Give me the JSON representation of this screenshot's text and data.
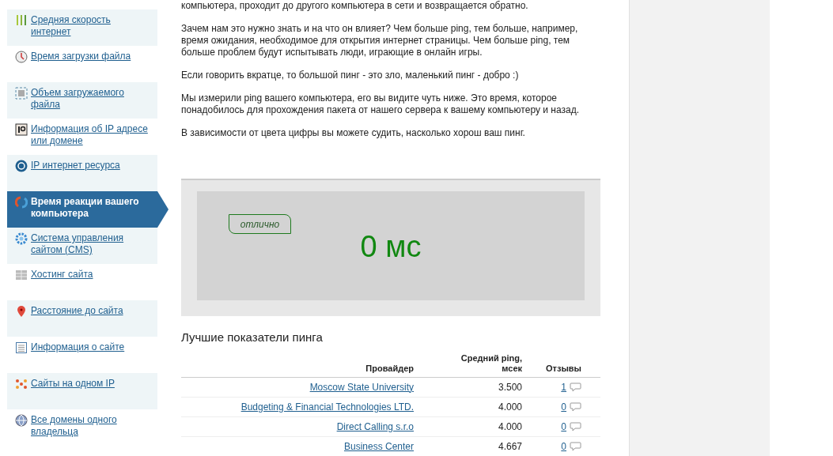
{
  "sidebar": {
    "items": [
      {
        "label": "Средняя скорость интернет",
        "selected": false
      },
      {
        "label": "Время загрузки файла",
        "selected": false
      },
      {
        "label": "Объем загружаемого файла",
        "selected": false
      },
      {
        "label": "Информация об IP адресе или домене",
        "selected": false
      },
      {
        "label": "IP интернет ресурса",
        "selected": false
      },
      {
        "label": "Время реакции вашего компьютера",
        "selected": true
      },
      {
        "label": "Система управления сайтом (CMS)",
        "selected": false
      },
      {
        "label": "Хостинг сайта",
        "selected": false
      },
      {
        "label": "Расстояние до сайта",
        "selected": false
      },
      {
        "label": "Информация о сайте",
        "selected": false
      },
      {
        "label": "Сайты на одном IP",
        "selected": false
      },
      {
        "label": "Все домены одного владельца",
        "selected": false
      }
    ]
  },
  "article": {
    "paragraphs": [
      "компьютера, проходит до другого компьютера в сети и возвращается обратно.",
      "Зачем нам это нужно знать и на что он влияет? Чем больше ping, тем больше, например, время ожидания, необходимое для открытия интернет страницы. Чем больше ping, тем больше проблем будут испытывать люди, играющие в онлайн игры.",
      "Если говорить вкратце, то большой пинг - это зло, маленький пинг - добро :)",
      "Мы измерили ping вашего компьютера, его вы видите чуть ниже. Это время, которое понадобилось для прохождения пакета от нашего сервера к вашему компьютеру и назад.",
      "В зависимости от цвета цифры вы можете судить, насколько хорош ваш пинг."
    ]
  },
  "ping_result": {
    "rating": "отлично",
    "value": "0 мс"
  },
  "ratings_table": {
    "title": "Лучшие показатели пинга",
    "columns": [
      "Провайдер",
      "Средний ping, мсек",
      "Отзывы"
    ],
    "rows": [
      {
        "provider": "Moscow State University",
        "ping": "3.500",
        "reviews": "1"
      },
      {
        "provider": "Budgeting & Financial Technologies LTD.",
        "ping": "4.000",
        "reviews": "0"
      },
      {
        "provider": "Direct Calling s.r.o",
        "ping": "4.000",
        "reviews": "0"
      },
      {
        "provider": "Business Center",
        "ping": "4.667",
        "reviews": "0"
      }
    ]
  }
}
